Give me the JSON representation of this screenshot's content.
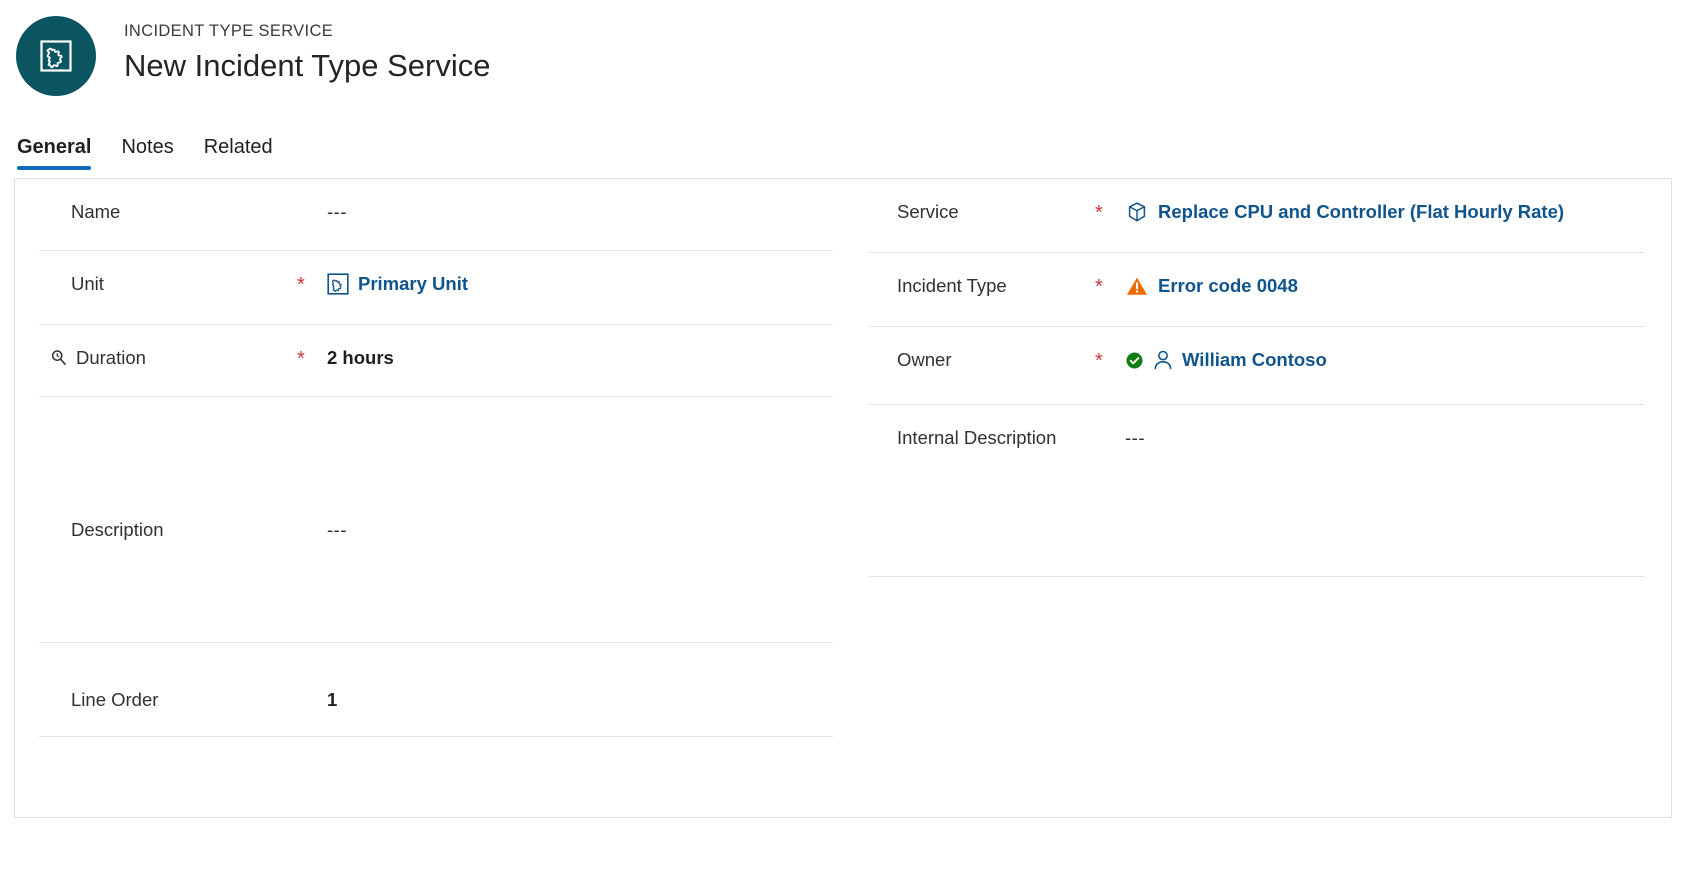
{
  "header": {
    "entity_kind": "INCIDENT TYPE SERVICE",
    "record_title": "New Incident Type Service",
    "avatar_icon": "puzzle-piece-icon",
    "avatar_color": "#0a5560"
  },
  "tabs": [
    {
      "label": "General",
      "active": true
    },
    {
      "label": "Notes",
      "active": false
    },
    {
      "label": "Related",
      "active": false
    }
  ],
  "accent_color": "#0f6cbd",
  "required_marker": "*",
  "form": {
    "left_column": [
      {
        "label": "Name",
        "required": false,
        "value": "---",
        "value_type": "placeholder",
        "icon": null,
        "label_icon": null
      },
      {
        "label": "Unit",
        "required": true,
        "value": "Primary Unit",
        "value_type": "lookup-link",
        "icon": "unit-puzzle-icon",
        "label_icon": null
      },
      {
        "label": "Duration",
        "required": true,
        "value": "2 hours",
        "value_type": "bold-text",
        "icon": null,
        "label_icon": "magnifier-icon"
      },
      {
        "label": "Description",
        "required": false,
        "value": "---",
        "value_type": "placeholder",
        "icon": null,
        "label_icon": null
      },
      {
        "label": "Line Order",
        "required": false,
        "value": "1",
        "value_type": "bold-text",
        "icon": null,
        "label_icon": null
      }
    ],
    "right_column": [
      {
        "label": "Service",
        "required": true,
        "value": "Replace CPU and Controller (Flat Hourly Rate)",
        "value_type": "lookup-link",
        "icon": "box-3d-icon",
        "status_icon": null
      },
      {
        "label": "Incident Type",
        "required": true,
        "value": "Error code 0048",
        "value_type": "lookup-link",
        "icon": "warning-triangle-icon",
        "status_icon": null
      },
      {
        "label": "Owner",
        "required": true,
        "value": "William Contoso",
        "value_type": "lookup-link",
        "icon": "person-icon",
        "status_icon": "presence-available-icon"
      },
      {
        "label": "Internal Description",
        "required": false,
        "value": "---",
        "value_type": "placeholder",
        "icon": null,
        "status_icon": null
      }
    ]
  },
  "colors": {
    "link": "#0f548c",
    "required_star": "#d13438",
    "warning": "#ef6c00",
    "available_green": "#107c10",
    "divider": "#e6e4e2"
  }
}
